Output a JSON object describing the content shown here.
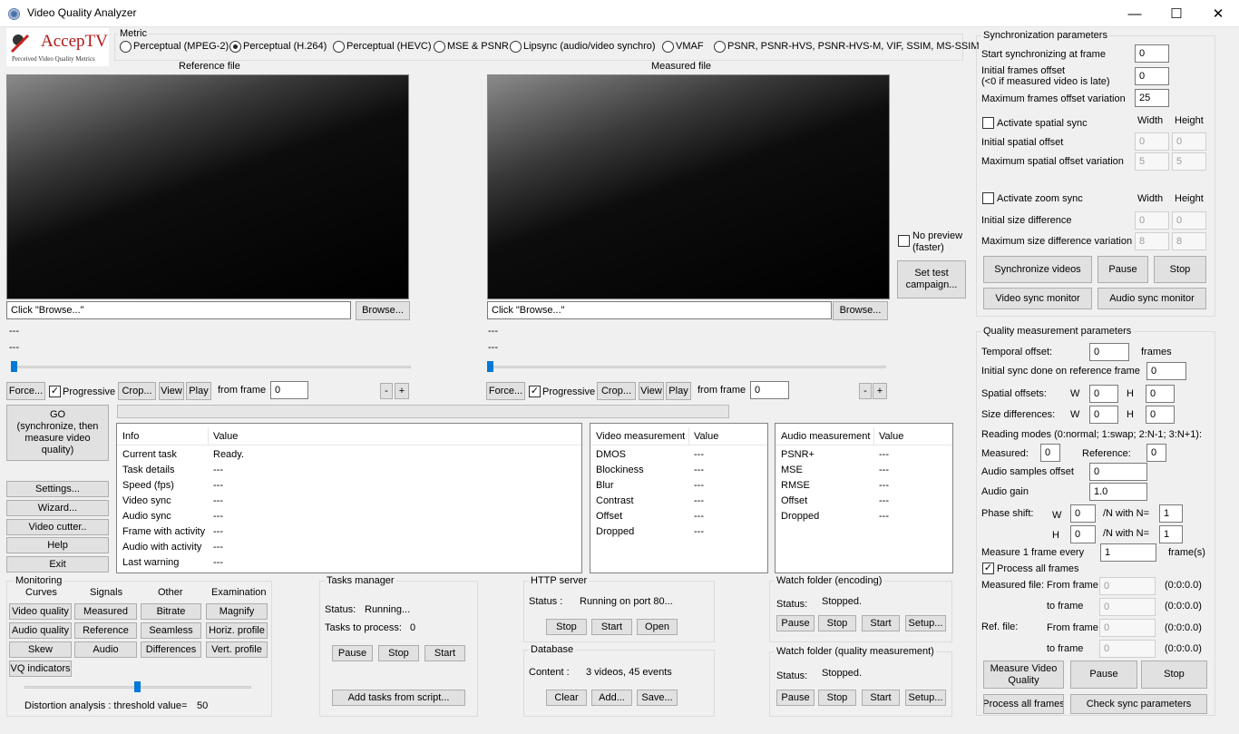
{
  "window": {
    "title": "Video Quality Analyzer",
    "minimize": "—",
    "maximize": "☐",
    "close": "✕"
  },
  "logo": {
    "brand": "AccepTV",
    "tagline": "Perceived Video Quality Metrics"
  },
  "metric": {
    "label": "Metric",
    "options": [
      "Perceptual (MPEG-2)",
      "Perceptual (H.264)",
      "Perceptual (HEVC)",
      "MSE & PSNR",
      "Lipsync (audio/video synchro)",
      "VMAF",
      "PSNR, PSNR-HVS, PSNR-HVS-M, VIF, SSIM, MS-SSIM"
    ],
    "selected_index": 1
  },
  "reference": {
    "title": "Reference file",
    "path": "Click \"Browse...\"",
    "browse": "Browse...",
    "line1": "---",
    "line2": "---",
    "force": "Force...",
    "progressive": "Progressive",
    "crop": "Crop...",
    "view": "View",
    "play": "Play",
    "from_frame_label": "from frame",
    "from_frame": "0",
    "minus": "-",
    "plus": "+"
  },
  "measured": {
    "title": "Measured file",
    "path": "Click \"Browse...\"",
    "browse": "Browse...",
    "line1": "---",
    "line2": "---",
    "force": "Force...",
    "progressive": "Progressive",
    "crop": "Crop...",
    "view": "View",
    "play": "Play",
    "from_frame_label": "from frame",
    "from_frame": "0",
    "minus": "-",
    "plus": "+"
  },
  "preview": {
    "no_preview_1": "No preview",
    "no_preview_2": "(faster)",
    "set_test_1": "Set test",
    "set_test_2": "campaign..."
  },
  "go": {
    "line1": "GO",
    "line2": "(synchronize, then",
    "line3": "measure video",
    "line4": "quality)"
  },
  "side_buttons": {
    "settings": "Settings...",
    "wizard": "Wizard...",
    "video_cutter": "Video cutter..",
    "help": "Help",
    "exit": "Exit"
  },
  "info_table": {
    "col1": "Info",
    "col2": "Value",
    "rows": [
      [
        "Current task",
        "Ready."
      ],
      [
        "Task details",
        "---"
      ],
      [
        "Speed (fps)",
        "---"
      ],
      [
        "Video sync",
        "---"
      ],
      [
        "Audio sync",
        "---"
      ],
      [
        "Frame with activity",
        "---"
      ],
      [
        "Audio with activity",
        "---"
      ],
      [
        "Last warning",
        "---"
      ]
    ]
  },
  "video_table": {
    "col1": "Video measurement",
    "col2": "Value",
    "rows": [
      [
        "DMOS",
        "---"
      ],
      [
        "Blockiness",
        "---"
      ],
      [
        "Blur",
        "---"
      ],
      [
        "Contrast",
        "---"
      ],
      [
        "Offset",
        "---"
      ],
      [
        "Dropped",
        "---"
      ]
    ]
  },
  "audio_table": {
    "col1": "Audio measurement",
    "col2": "Value",
    "rows": [
      [
        "PSNR+",
        "---"
      ],
      [
        "MSE",
        "---"
      ],
      [
        "RMSE",
        "---"
      ],
      [
        "Offset",
        "---"
      ],
      [
        "Dropped",
        "---"
      ]
    ]
  },
  "monitoring": {
    "title": "Monitoring",
    "curves": "Curves",
    "signals": "Signals",
    "other": "Other",
    "examination": "Examination",
    "video_quality": "Video quality",
    "measured": "Measured",
    "bitrate": "Bitrate",
    "magnify": "Magnify",
    "audio_quality": "Audio quality",
    "reference": "Reference",
    "seamless": "Seamless",
    "horiz_profile": "Horiz. profile",
    "skew": "Skew",
    "audio": "Audio",
    "differences": "Differences",
    "vert_profile": "Vert. profile",
    "vq_indicators": "VQ indicators",
    "distortion_label": "Distortion analysis : threshold value=",
    "distortion_value": "50"
  },
  "tasks": {
    "title": "Tasks manager",
    "status_label": "Status:",
    "status": "Running...",
    "to_process_label": "Tasks to process:",
    "to_process": "0",
    "pause": "Pause",
    "stop": "Stop",
    "start": "Start",
    "add": "Add tasks from script..."
  },
  "http": {
    "title": "HTTP server",
    "status_label": "Status :",
    "status": "Running on port 80...",
    "stop": "Stop",
    "start": "Start",
    "open": "Open"
  },
  "database": {
    "title": "Database",
    "content_label": "Content :",
    "content": "3 videos, 45 events",
    "clear": "Clear",
    "add": "Add...",
    "save": "Save..."
  },
  "watch_enc": {
    "title": "Watch folder (encoding)",
    "status_label": "Status:",
    "status": "Stopped.",
    "pause": "Pause",
    "stop": "Stop",
    "start": "Start",
    "setup": "Setup..."
  },
  "watch_qm": {
    "title": "Watch folder (quality measurement)",
    "status_label": "Status:",
    "status": "Stopped.",
    "pause": "Pause",
    "stop": "Stop",
    "start": "Start",
    "setup": "Setup..."
  },
  "sync": {
    "title": "Synchronization parameters",
    "start_label": "Start synchronizing at frame",
    "start": "0",
    "initial_label_1": "Initial frames offset",
    "initial_label_2": "(<0 if measured video is late)",
    "initial": "0",
    "max_label": "Maximum frames offset variation",
    "max": "25",
    "spatial_label": "Activate spatial sync",
    "width": "Width",
    "height": "Height",
    "init_spatial_label": "Initial spatial offset",
    "init_spatial_w": "0",
    "init_spatial_h": "0",
    "max_spatial_label": "Maximum spatial offset variation",
    "max_spatial_w": "5",
    "max_spatial_h": "5",
    "zoom_label": "Activate zoom sync",
    "width2": "Width",
    "height2": "Height",
    "init_size_label": "Initial size difference",
    "init_size_w": "0",
    "init_size_h": "0",
    "max_size_label": "Maximum size difference variation",
    "max_size_w": "8",
    "max_size_h": "8",
    "sync_videos": "Synchronize videos",
    "pause": "Pause",
    "stop": "Stop",
    "video_monitor": "Video sync monitor",
    "audio_monitor": "Audio sync monitor"
  },
  "quality": {
    "title": "Quality measurement parameters",
    "temporal_label": "Temporal offset:",
    "temporal": "0",
    "frames": "frames",
    "initial_sync_label": "Initial sync done on reference frame",
    "initial_sync": "0",
    "spatial_label": "Spatial offsets:",
    "w": "W",
    "h": "H",
    "spatial_w": "0",
    "spatial_h": "0",
    "size_label": "Size differences:",
    "size_w": "0",
    "size_h": "0",
    "reading_label": "Reading modes (0:normal; 1:swap; 2:N-1; 3:N+1):",
    "measured_label": "Measured:",
    "measured": "0",
    "reference_label": "Reference:",
    "reference": "0",
    "audio_offset_label": "Audio samples offset",
    "audio_offset": "0",
    "gain_label": "Audio gain",
    "gain": "1.0",
    "phase_label": "Phase shift:",
    "phase_w": "0",
    "phase_h": "0",
    "n_with": "/N with N=",
    "phase_nw": "1",
    "phase_nh": "1",
    "every_label": "Measure 1 frame every",
    "every": "1",
    "frames_unit": "frame(s)",
    "process_all": "Process all frames",
    "mfile_label": "Measured file:",
    "from_frame": "From frame",
    "to_frame": "to frame",
    "mfrom": "0",
    "mto": "0",
    "mfrom_tc": "(0:0:0.0)",
    "mto_tc": "(0:0:0.0)",
    "rfile_label": "Ref. file:",
    "rfrom": "0",
    "rto": "0",
    "rfrom_tc": "(0:0:0.0)",
    "rto_tc": "(0:0:0.0)",
    "measure_vq_1": "Measure Video",
    "measure_vq_2": "Quality",
    "pause": "Pause",
    "stop": "Stop",
    "process_all_btn": "Process all frames",
    "check_sync": "Check sync parameters"
  },
  "sliders": {
    "reference_pos": 0,
    "measured_pos": 0,
    "distortion_pos": 0.5
  }
}
